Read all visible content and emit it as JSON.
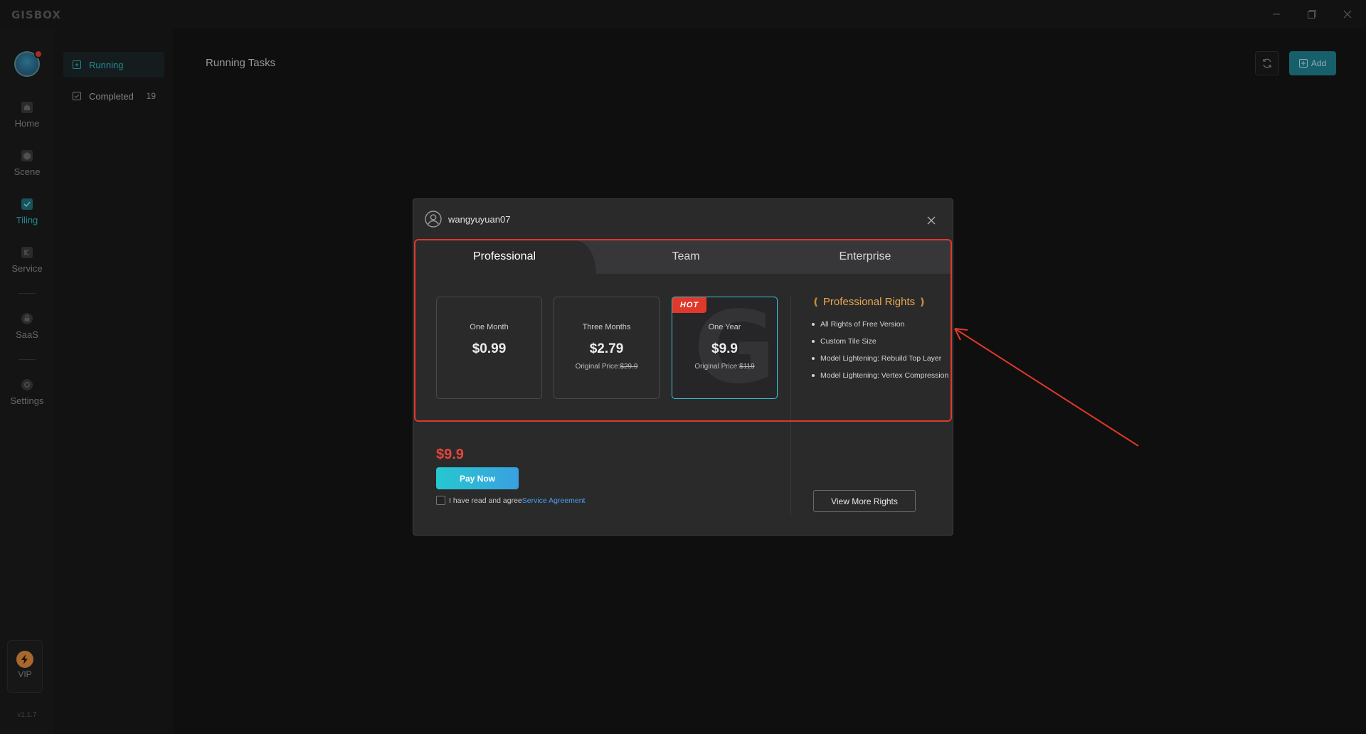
{
  "app": {
    "logo": "GISBOX"
  },
  "rail": {
    "items": [
      {
        "label": "Home",
        "icon": "home-icon"
      },
      {
        "label": "Scene",
        "icon": "cube-icon"
      },
      {
        "label": "Tiling",
        "icon": "tiling-icon"
      },
      {
        "label": "Service",
        "icon": "service-icon"
      },
      {
        "label": "SaaS",
        "icon": "lock-icon"
      },
      {
        "label": "Settings",
        "icon": "gear-icon"
      }
    ],
    "vip_label": "VIP",
    "version": "v1.1.7"
  },
  "subnav": {
    "items": [
      {
        "label": "Running"
      },
      {
        "label": "Completed",
        "count": "19"
      }
    ]
  },
  "main": {
    "title": "Running Tasks",
    "add_label": "Add"
  },
  "modal": {
    "username": "wangyuyuan07",
    "tabs": [
      {
        "label": "Professional"
      },
      {
        "label": "Team"
      },
      {
        "label": "Enterprise"
      }
    ],
    "plans": [
      {
        "name": "One Month",
        "price": "$0.99",
        "orig_prefix": "",
        "orig_price": ""
      },
      {
        "name": "Three Months",
        "price": "$2.79",
        "orig_prefix": "Original Price:",
        "orig_price": "$29.9"
      },
      {
        "name": "One Year",
        "price": "$9.9",
        "orig_prefix": "Original Price:",
        "orig_price": "$119",
        "badge": "HOT",
        "watermark": "G"
      }
    ],
    "rights_title": "Professional Rights",
    "rights": [
      "All Rights of Free Version",
      "Custom Tile Size",
      "Model Lightening: Rebuild Top Layer",
      "Model Lightening: Vertex Compression"
    ],
    "total_price": "$9.9",
    "pay_label": "Pay Now",
    "agree_text": "I have read and agree",
    "agree_link": "Service Agreement",
    "more_rights_label": "View More Rights"
  },
  "colors": {
    "accent": "#2fb6c6",
    "price_red": "#e8453a",
    "rights_gold": "#e8a84e",
    "annotation_red": "#e0382a"
  }
}
